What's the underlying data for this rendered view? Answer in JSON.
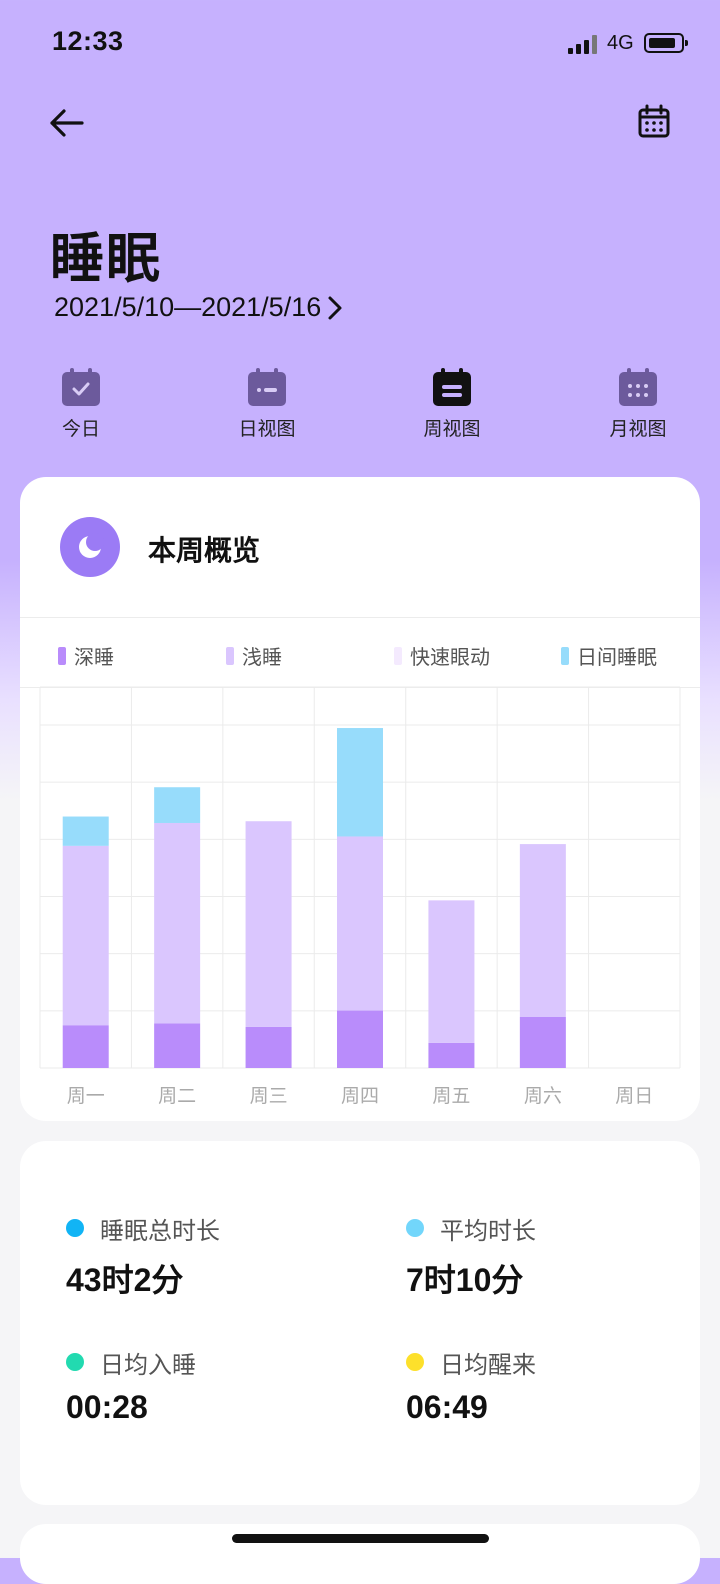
{
  "status_bar": {
    "time": "12:33",
    "network": "4G"
  },
  "header": {
    "title": "睡眠",
    "date_range": "2021/5/10—2021/5/16"
  },
  "view_tabs": [
    {
      "label": "今日",
      "icon": "calendar-check-icon",
      "active": false
    },
    {
      "label": "日视图",
      "icon": "calendar-day-icon",
      "active": false
    },
    {
      "label": "周视图",
      "icon": "calendar-week-icon",
      "active": true
    },
    {
      "label": "月视图",
      "icon": "calendar-month-icon",
      "active": false
    }
  ],
  "overview": {
    "title": "本周概览",
    "icon": "moon-icon",
    "legend": [
      {
        "label": "深睡",
        "color": "#b98cfb"
      },
      {
        "label": "浅睡",
        "color": "#dac6fe"
      },
      {
        "label": "快速眼动",
        "color": "#f4eafe"
      },
      {
        "label": "日间睡眠",
        "color": "#97dcfb"
      }
    ]
  },
  "chart_data": {
    "type": "bar",
    "stacked": true,
    "categories": [
      "周一",
      "周二",
      "周三",
      "周四",
      "周五",
      "周六",
      "周日"
    ],
    "series": [
      {
        "name": "深睡",
        "color": "#b98cfb",
        "values": [
          0.73,
          0.76,
          0.7,
          0.98,
          0.43,
          0.87,
          0
        ]
      },
      {
        "name": "浅睡",
        "color": "#dac6fe",
        "values": [
          3.06,
          3.42,
          3.51,
          2.97,
          2.43,
          2.95,
          0
        ]
      },
      {
        "name": "快速眼动",
        "color": "#f4eafe",
        "values": [
          0,
          0,
          0,
          0,
          0,
          0,
          0
        ]
      },
      {
        "name": "日间睡眠",
        "color": "#97dcfb",
        "values": [
          0.5,
          0.61,
          0,
          1.85,
          0,
          0,
          0
        ]
      }
    ],
    "ylim": [
      0,
      6.5
    ],
    "grid": true
  },
  "stats": [
    {
      "label": "睡眠总时长",
      "value": "43时2分",
      "color": "#11b4f5"
    },
    {
      "label": "平均时长",
      "value": "7时10分",
      "color": "#72d6fb"
    },
    {
      "label": "日均入睡",
      "value": "00:28",
      "color": "#22dab0"
    },
    {
      "label": "日均醒来",
      "value": "06:49",
      "color": "#fde02b"
    }
  ]
}
